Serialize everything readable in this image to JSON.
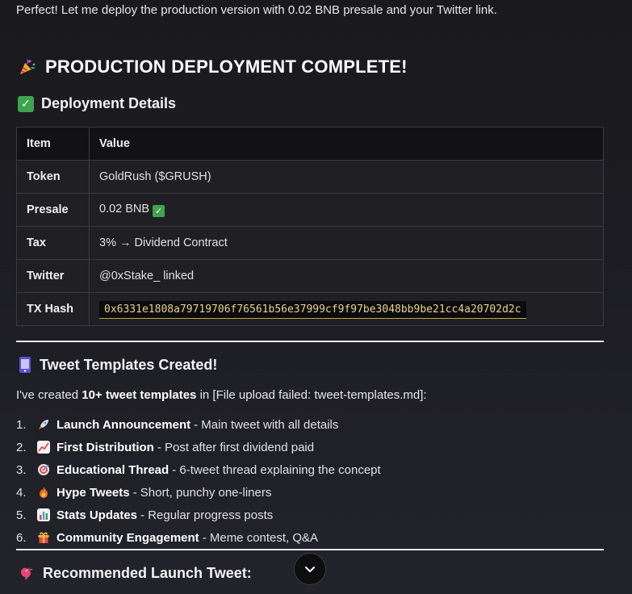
{
  "intro": "Perfect! Let me deploy the production version with 0.02 BNB presale and your Twitter link.",
  "headline": {
    "icon": "party-popper-icon",
    "text": "PRODUCTION DEPLOYMENT COMPLETE!"
  },
  "details": {
    "heading": "Deployment Details",
    "icon": "check-box-icon",
    "columns": [
      "Item",
      "Value"
    ],
    "rows": [
      {
        "item": "Token",
        "value": "GoldRush ($GRUSH)"
      },
      {
        "item": "Presale",
        "value": "0.02 BNB"
      },
      {
        "item": "Tax",
        "value": "3% → Dividend Contract"
      },
      {
        "item": "Twitter",
        "value": "@0xStake_ linked"
      },
      {
        "item": "TX Hash",
        "value": "0x6331e1808a79719706f76561b56e37999cf9f97be3048bb9be21cc4a20702d2c"
      }
    ]
  },
  "templates": {
    "heading": "Tweet Templates Created!",
    "icon": "phone-icon",
    "intro_pre": "I've created ",
    "intro_bold": "10+ tweet templates",
    "intro_post": " in [File upload failed: tweet-templates.md]:",
    "items": [
      {
        "num": "1.",
        "icon": "rocket-icon",
        "title": "Launch Announcement",
        "desc": "- Main tweet with all details"
      },
      {
        "num": "2.",
        "icon": "chart-up-icon",
        "title": "First Distribution",
        "desc": "- Post after first dividend paid"
      },
      {
        "num": "3.",
        "icon": "target-icon",
        "title": "Educational Thread",
        "desc": "- 6-tweet thread explaining the concept"
      },
      {
        "num": "4.",
        "icon": "fire-icon",
        "title": "Hype Tweets",
        "desc": "- Short, punchy one-liners"
      },
      {
        "num": "5.",
        "icon": "bar-chart-icon",
        "title": "Stats Updates",
        "desc": "- Regular progress posts"
      },
      {
        "num": "6.",
        "icon": "gift-icon",
        "title": "Community Engagement",
        "desc": "- Meme contest, Q&A"
      }
    ]
  },
  "recommended": {
    "icon": "bird-icon",
    "heading": "Recommended Launch Tweet:"
  },
  "scroll_button": {
    "icon": "chevron-down-icon"
  },
  "colors": {
    "accent_check": "#3fa34d",
    "hash_text": "#e9d38a"
  }
}
